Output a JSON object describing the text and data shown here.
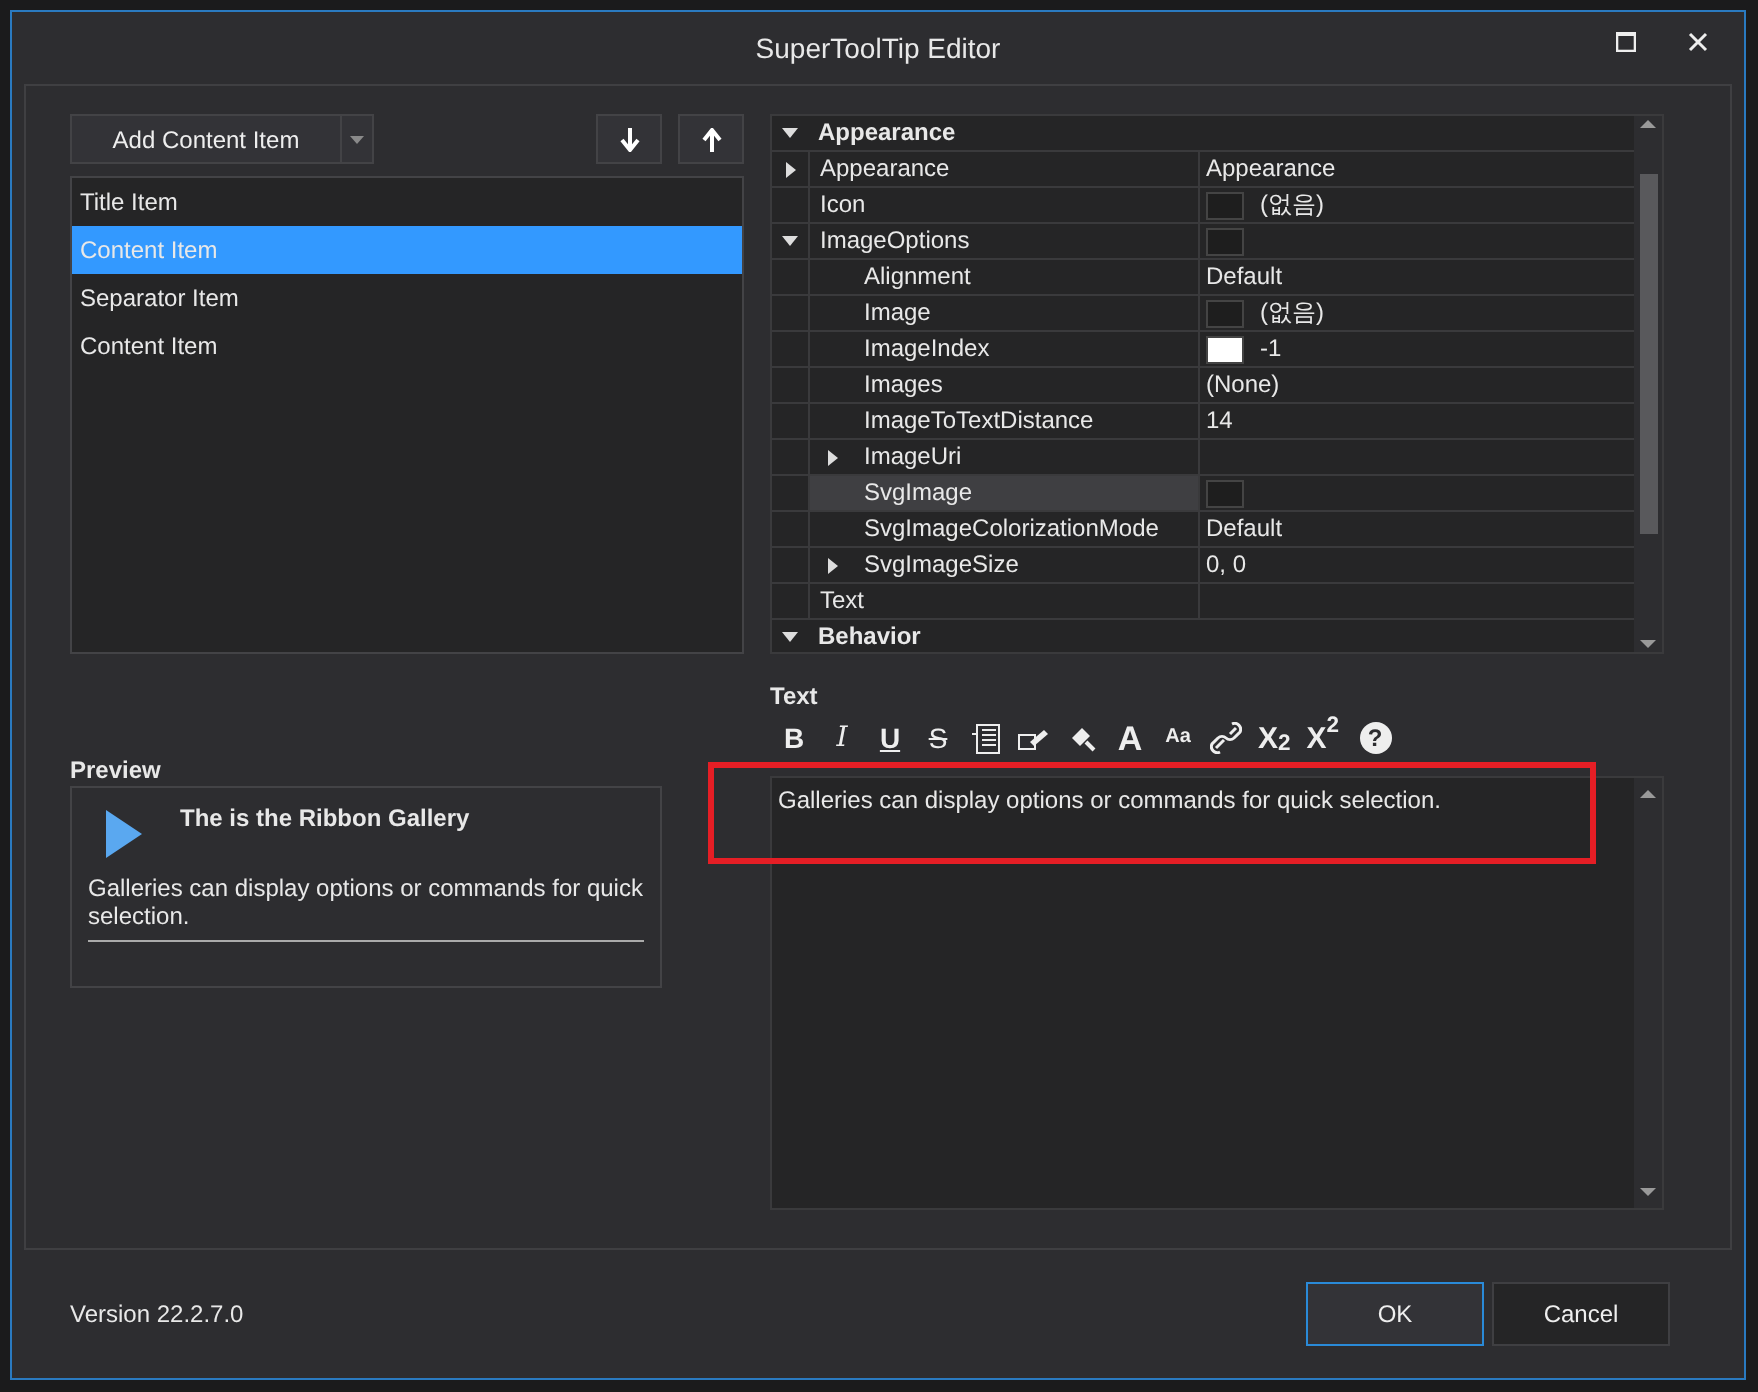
{
  "window": {
    "title": "SuperToolTip Editor"
  },
  "add_button": {
    "label": "Add Content Item"
  },
  "items": [
    {
      "label": "Title Item",
      "selected": false
    },
    {
      "label": "Content Item",
      "selected": true
    },
    {
      "label": "Separator Item",
      "selected": false
    },
    {
      "label": "Content Item",
      "selected": false
    }
  ],
  "property_grid": {
    "categories": [
      {
        "name": "Appearance",
        "expanded": true,
        "rows": [
          {
            "name": "Appearance",
            "value": "Appearance",
            "expanded": false,
            "selected": false
          },
          {
            "name": "Icon",
            "value": "(없음)",
            "color": "#1e1e1e",
            "selected": false
          },
          {
            "name": "ImageOptions",
            "color": "#1e1e1e",
            "expanded": true,
            "selected": false,
            "children": [
              {
                "name": "Alignment",
                "value": "Default",
                "selected": false
              },
              {
                "name": "Image",
                "value": "(없음)",
                "color": "#1e1e1e",
                "selected": false
              },
              {
                "name": "ImageIndex",
                "value": "-1",
                "color": "#ffffff",
                "selected": false
              },
              {
                "name": "Images",
                "value": "(None)",
                "selected": false
              },
              {
                "name": "ImageToTextDistance",
                "value": "14",
                "selected": false
              },
              {
                "name": "ImageUri",
                "expanded": false,
                "selected": false
              },
              {
                "name": "SvgImage",
                "color": "#1e1e1e",
                "selected": true
              },
              {
                "name": "SvgImageColorizationMode",
                "value": "Default",
                "selected": false
              },
              {
                "name": "SvgImageSize",
                "value": "0, 0",
                "expanded": false,
                "selected": false
              }
            ]
          },
          {
            "name": "Text",
            "selected": false
          }
        ]
      },
      {
        "name": "Behavior",
        "expanded": true
      }
    ]
  },
  "text_editor": {
    "label": "Text",
    "toolbar": [
      {
        "kind": "bold",
        "label": "B"
      },
      {
        "kind": "italic",
        "label": "I"
      },
      {
        "kind": "underline",
        "label": "U"
      },
      {
        "kind": "strike",
        "label": "S"
      },
      {
        "kind": "list"
      },
      {
        "kind": "edit"
      },
      {
        "kind": "brush"
      },
      {
        "kind": "font-size",
        "label": "A"
      },
      {
        "kind": "case",
        "label": "Aa"
      },
      {
        "kind": "link"
      },
      {
        "kind": "script",
        "label": "X$_{2}$"
      },
      {
        "kind": "script",
        "label": "X$^{2}$"
      },
      {
        "kind": "help",
        "label": "?"
      }
    ],
    "content": "Galleries can display options or commands for quick selection.",
    "highlighted": true
  },
  "preview": {
    "label": "Preview",
    "title": "The is the Ribbon Gallery",
    "body": "Galleries can display options or commands for quick selection."
  },
  "footer": {
    "version": "Version 22.2.7.0",
    "buttons": [
      {
        "label": "OK",
        "focused": true
      },
      {
        "label": "Cancel",
        "focused": false
      }
    ]
  }
}
